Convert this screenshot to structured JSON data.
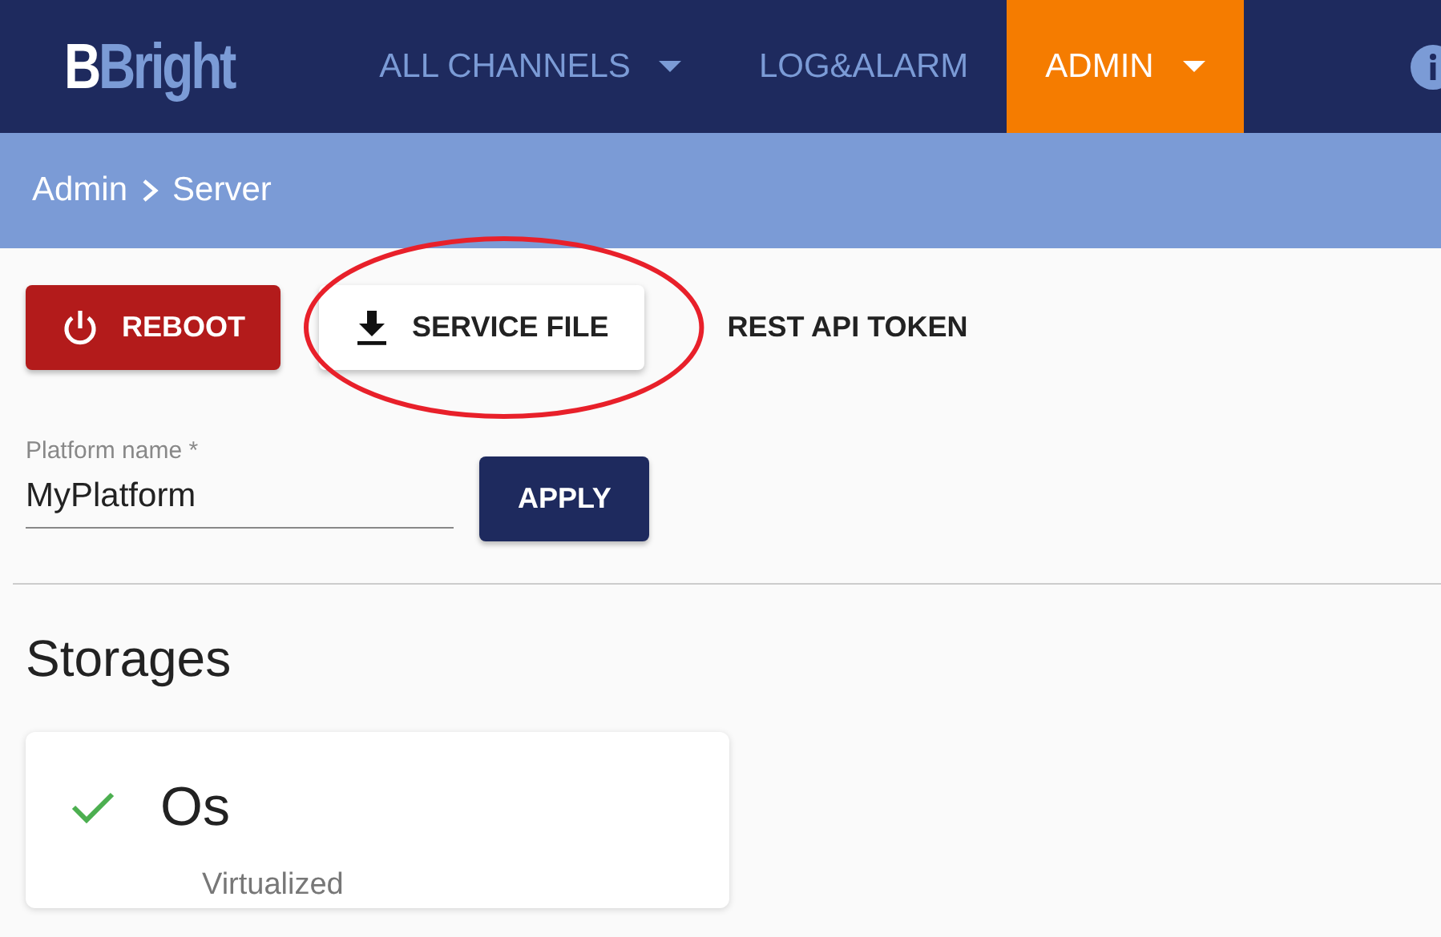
{
  "logo": {
    "first": "B",
    "rest": "Bright"
  },
  "nav": [
    {
      "label": "ALL CHANNELS",
      "dropdown": true,
      "selected": false
    },
    {
      "label": "LOG&ALARM",
      "dropdown": false,
      "selected": false
    },
    {
      "label": "ADMIN",
      "dropdown": true,
      "selected": true
    }
  ],
  "breadcrumb": [
    "Admin",
    "Server"
  ],
  "actions": [
    {
      "label": "REBOOT",
      "kind": "danger",
      "circled": false
    },
    {
      "label": "SERVICE FILE",
      "kind": "raised",
      "circled": true
    },
    {
      "label": "REST API TOKEN",
      "kind": "flat",
      "circled": false
    }
  ],
  "annotation": {
    "color": "#e8202a"
  },
  "platform_field": {
    "label": "Platform name *",
    "value": "MyPlatform"
  },
  "apply_button": "APPLY",
  "storages_title": "Storages",
  "storages": [
    {
      "name": "Os",
      "subtitle": "Virtualized",
      "checked": true
    }
  ]
}
